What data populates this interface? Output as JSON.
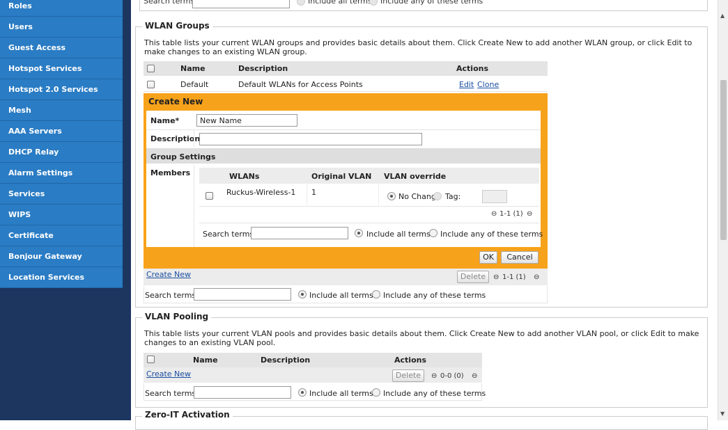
{
  "nav": {
    "items": [
      {
        "id": "roles",
        "label": "Roles"
      },
      {
        "id": "users",
        "label": "Users"
      },
      {
        "id": "guest-access",
        "label": "Guest Access"
      },
      {
        "id": "hotspot-services",
        "label": "Hotspot Services"
      },
      {
        "id": "hotspot-20-services",
        "label": "Hotspot 2.0 Services"
      },
      {
        "id": "mesh",
        "label": "Mesh"
      },
      {
        "id": "aaa-servers",
        "label": "AAA Servers"
      },
      {
        "id": "dhcp-relay",
        "label": "DHCP Relay"
      },
      {
        "id": "alarm-settings",
        "label": "Alarm Settings"
      },
      {
        "id": "services",
        "label": "Services"
      },
      {
        "id": "wips",
        "label": "WIPS"
      },
      {
        "id": "certificate",
        "label": "Certificate"
      },
      {
        "id": "bonjour-gateway",
        "label": "Bonjour Gateway"
      },
      {
        "id": "location-services",
        "label": "Location Services"
      }
    ]
  },
  "top_partial": {
    "search_label": "Search terms",
    "include_all": "Include all terms",
    "include_any": "Include any of these terms"
  },
  "wlan_groups": {
    "title": "WLAN Groups",
    "description": "This table lists your current WLAN groups and provides basic details about them. Click Create New to add another WLAN group, or click Edit to make changes to an existing WLAN group.",
    "headers": {
      "name": "Name",
      "description": "Description",
      "actions": "Actions"
    },
    "rows": [
      {
        "name": "Default",
        "description": "Default WLANs for Access Points",
        "edit": "Edit",
        "clone": "Clone"
      }
    ],
    "create_new": {
      "title": "Create New",
      "name_label": "Name*",
      "name_value": "New Name",
      "description_label": "Description",
      "description_value": "",
      "group_settings": "Group Settings",
      "members_label": "Members",
      "members_headers": {
        "wlans": "WLANs",
        "original_vlan": "Original VLAN",
        "vlan_override": "VLAN override"
      },
      "members_rows": [
        {
          "wlan": "Ruckus-Wireless-1",
          "original_vlan": "1",
          "no_change": "No Change",
          "tag": "Tag:"
        }
      ],
      "members_pager": "1-1 (1)",
      "search_label": "Search terms",
      "include_all": "Include all terms",
      "include_any": "Include any of these terms",
      "ok": "OK",
      "cancel": "Cancel"
    },
    "footer": {
      "create_new": "Create New",
      "delete": "Delete",
      "pager": "1-1 (1)",
      "search_label": "Search terms",
      "include_all": "Include all terms",
      "include_any": "Include any of these terms"
    }
  },
  "vlan_pooling": {
    "title": "VLAN Pooling",
    "description": "This table lists your current VLAN pools and provides basic details about them. Click Create New to add another VLAN pool, or click Edit to make changes to an existing VLAN pool.",
    "headers": {
      "name": "Name",
      "description": "Description",
      "actions": "Actions"
    },
    "footer": {
      "create_new": "Create New",
      "delete": "Delete",
      "pager": "0-0 (0)",
      "search_label": "Search terms",
      "include_all": "Include all terms",
      "include_any": "Include any of these terms"
    }
  },
  "zero_it": {
    "title": "Zero-IT Activation"
  },
  "colors": {
    "nav_bg": "#2a7cc4",
    "dark": "#1c3660",
    "orange": "#f7a21b",
    "link": "#1a4ea1"
  }
}
